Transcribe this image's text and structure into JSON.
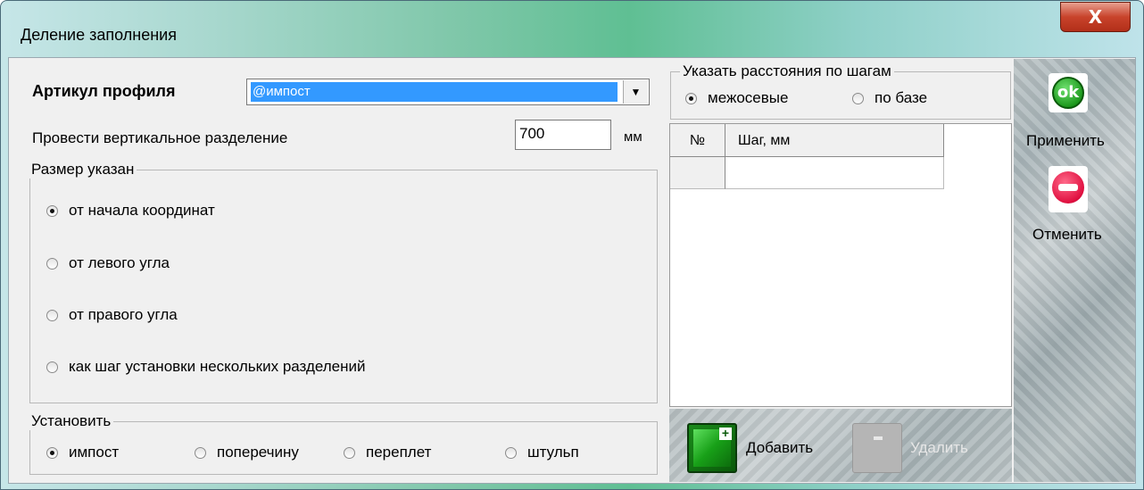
{
  "window": {
    "title": "Деление заполнения",
    "close_glyph": "X"
  },
  "profile": {
    "label": "Артикул профиля",
    "selected": "@импост",
    "dropdown_glyph": "▼"
  },
  "vertical_split": {
    "label": "Провести вертикальное разделение",
    "value": "700",
    "unit": "мм"
  },
  "size_group": {
    "title": "Размер указан",
    "options": [
      {
        "label": "от начала координат",
        "checked": true
      },
      {
        "label": "от левого угла",
        "checked": false
      },
      {
        "label": "от правого угла",
        "checked": false
      },
      {
        "label": "как шаг установки нескольких разделений",
        "checked": false
      }
    ]
  },
  "install_group": {
    "title": "Установить",
    "options": [
      {
        "label": "импост",
        "checked": true
      },
      {
        "label": "поперечину",
        "checked": false
      },
      {
        "label": "переплет",
        "checked": false
      },
      {
        "label": "штульп",
        "checked": false
      }
    ]
  },
  "steps_group": {
    "title": "Указать расстояния по шагам",
    "options": [
      {
        "label": "межосевые",
        "checked": true
      },
      {
        "label": "по базе",
        "checked": false
      }
    ]
  },
  "grid": {
    "columns": [
      "№",
      "Шаг, мм"
    ],
    "rows": [
      [
        "",
        ""
      ]
    ]
  },
  "actions": {
    "apply_label": "Применить",
    "apply_glyph": "ok",
    "cancel_label": "Отменить",
    "add_label": "Добавить",
    "add_glyph": "+",
    "delete_label": "Удалить"
  },
  "colors": {
    "selection": "#3399ff",
    "ok_green": "#1e9a1e",
    "cancel_red": "#e01040"
  }
}
